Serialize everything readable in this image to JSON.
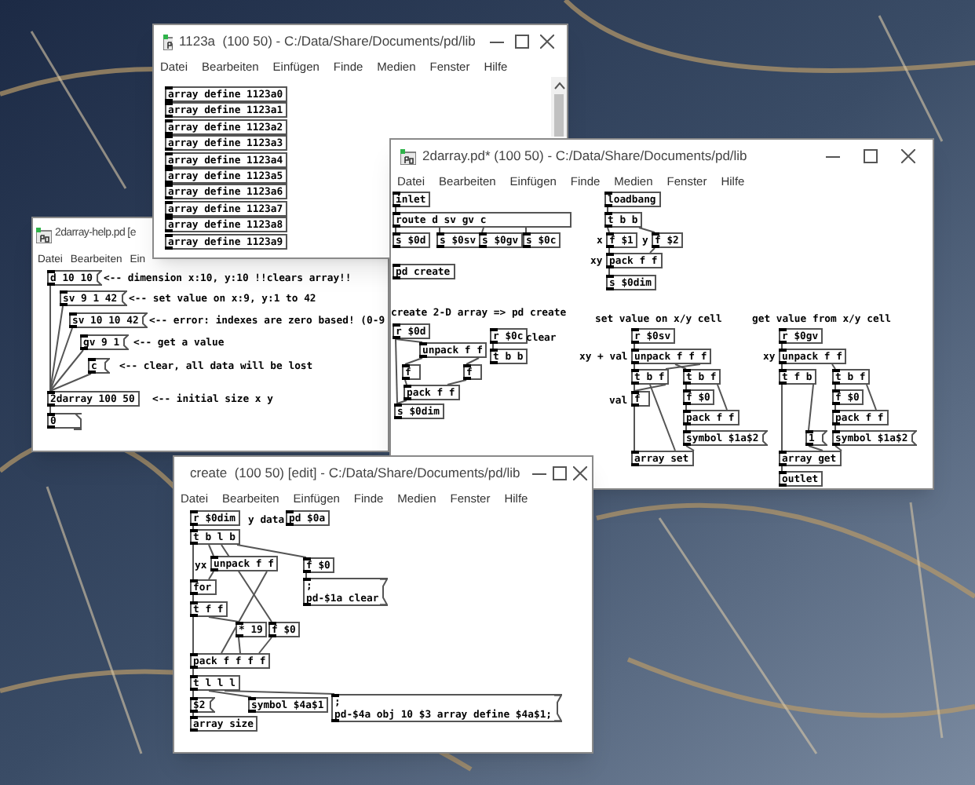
{
  "windows": [
    {
      "title": "1123a  (100 50) - C:/Data/Share/Documents/pd/lib",
      "menu": [
        "Datei",
        "Bearbeiten",
        "Einfügen",
        "Finde",
        "Medien",
        "Fenster",
        "Hilfe"
      ],
      "objects": [
        {
          "kind": "obj",
          "text": "array define 1123a0"
        },
        {
          "kind": "obj",
          "text": "array define 1123a1"
        },
        {
          "kind": "obj",
          "text": "array define 1123a2"
        },
        {
          "kind": "obj",
          "text": "array define 1123a3"
        },
        {
          "kind": "obj",
          "text": "array define 1123a4"
        },
        {
          "kind": "obj",
          "text": "array define 1123a5"
        },
        {
          "kind": "obj",
          "text": "array define 1123a6"
        },
        {
          "kind": "obj",
          "text": "array define 1123a7"
        },
        {
          "kind": "obj",
          "text": "array define 1123a8"
        },
        {
          "kind": "obj",
          "text": "array define 1123a9"
        }
      ]
    },
    {
      "title": "2darray.pd* (100 50) - C:/Data/Share/Documents/pd/lib",
      "menu": [
        "Datei",
        "Bearbeiten",
        "Einfügen",
        "Finde",
        "Medien",
        "Fenster",
        "Hilfe"
      ],
      "objects": [
        {
          "kind": "obj",
          "text": "inlet"
        },
        {
          "kind": "obj",
          "text": "route d sv gv c"
        },
        {
          "kind": "obj",
          "text": "s $0d"
        },
        {
          "kind": "obj",
          "text": "s $0sv"
        },
        {
          "kind": "obj",
          "text": "s $0gv"
        },
        {
          "kind": "obj",
          "text": "s $0c"
        },
        {
          "kind": "obj",
          "text": "pd create"
        },
        {
          "kind": "obj",
          "text": "loadbang"
        },
        {
          "kind": "obj",
          "text": "t b b"
        },
        {
          "kind": "comment",
          "text": "x"
        },
        {
          "kind": "obj",
          "text": "f $1"
        },
        {
          "kind": "comment",
          "text": "y"
        },
        {
          "kind": "obj",
          "text": "f $2"
        },
        {
          "kind": "comment",
          "text": "xy"
        },
        {
          "kind": "obj",
          "text": "pack f f"
        },
        {
          "kind": "obj",
          "text": "s $0dim"
        },
        {
          "kind": "comment",
          "text": "create 2-D array => pd create"
        },
        {
          "kind": "obj",
          "text": "r $0d"
        },
        {
          "kind": "obj",
          "text": "unpack f f"
        },
        {
          "kind": "obj",
          "text": "f"
        },
        {
          "kind": "obj",
          "text": "f"
        },
        {
          "kind": "obj",
          "text": "pack f f"
        },
        {
          "kind": "obj",
          "text": "s $0dim"
        },
        {
          "kind": "obj",
          "text": "r $0c"
        },
        {
          "kind": "comment",
          "text": "clear"
        },
        {
          "kind": "obj",
          "text": "t b b"
        },
        {
          "kind": "comment",
          "text": "set value on x/y cell"
        },
        {
          "kind": "obj",
          "text": "r $0sv"
        },
        {
          "kind": "comment",
          "text": "xy + val"
        },
        {
          "kind": "obj",
          "text": "unpack f f f"
        },
        {
          "kind": "obj",
          "text": "t b f"
        },
        {
          "kind": "obj",
          "text": "t b f"
        },
        {
          "kind": "comment",
          "text": "val"
        },
        {
          "kind": "obj",
          "text": "f"
        },
        {
          "kind": "obj",
          "text": "f $0"
        },
        {
          "kind": "obj",
          "text": "pack f f"
        },
        {
          "kind": "msg",
          "text": "symbol $1a$2"
        },
        {
          "kind": "obj",
          "text": "array set"
        },
        {
          "kind": "comment",
          "text": "get value from x/y cell"
        },
        {
          "kind": "obj",
          "text": "r $0gv"
        },
        {
          "kind": "comment",
          "text": "xy"
        },
        {
          "kind": "obj",
          "text": "unpack f f"
        },
        {
          "kind": "obj",
          "text": "t f b"
        },
        {
          "kind": "obj",
          "text": "t b f"
        },
        {
          "kind": "obj",
          "text": "f $0"
        },
        {
          "kind": "obj",
          "text": "pack f f"
        },
        {
          "kind": "msg",
          "text": "1"
        },
        {
          "kind": "msg",
          "text": "symbol $1a$2"
        },
        {
          "kind": "obj",
          "text": "array get"
        },
        {
          "kind": "obj",
          "text": "outlet"
        }
      ]
    },
    {
      "title": "2darray-help.pd [e",
      "menu": [
        "Datei",
        "Bearbeiten",
        "Ein"
      ],
      "objects": [
        {
          "kind": "msg",
          "text": "d 10 10"
        },
        {
          "kind": "comment",
          "text": "<-- dimension x:10, y:10 !!clears array!!"
        },
        {
          "kind": "msg",
          "text": "sv 9 1 42"
        },
        {
          "kind": "comment",
          "text": "<-- set value on x:9, y:1 to 42"
        },
        {
          "kind": "msg",
          "text": "sv 10 10 42"
        },
        {
          "kind": "comment",
          "text": "<-- error: indexes are zero based! (0-9"
        },
        {
          "kind": "msg",
          "text": "gv 9 1"
        },
        {
          "kind": "comment",
          "text": "<-- get a value"
        },
        {
          "kind": "msg",
          "text": "c"
        },
        {
          "kind": "comment",
          "text": "<-- clear, all data will be lost"
        },
        {
          "kind": "obj",
          "text": "2darray 100 50"
        },
        {
          "kind": "comment",
          "text": "<-- initial size x y"
        },
        {
          "kind": "number",
          "text": "0"
        }
      ]
    },
    {
      "title": "create  (100 50) [edit] - C:/Data/Share/Documents/pd/lib",
      "menu": [
        "Datei",
        "Bearbeiten",
        "Einfügen",
        "Finde",
        "Medien",
        "Fenster",
        "Hilfe"
      ],
      "objects": [
        {
          "kind": "obj",
          "text": "r $0dim"
        },
        {
          "kind": "comment",
          "text": "y data"
        },
        {
          "kind": "obj",
          "text": "pd $0a"
        },
        {
          "kind": "obj",
          "text": "t b l b"
        },
        {
          "kind": "comment",
          "text": "yx"
        },
        {
          "kind": "obj",
          "text": "unpack f f"
        },
        {
          "kind": "obj",
          "text": "f $0"
        },
        {
          "kind": "obj",
          "text": "for"
        },
        {
          "kind": "msg",
          "text": ";\npd-$1a clear"
        },
        {
          "kind": "obj",
          "text": "t f f"
        },
        {
          "kind": "obj",
          "text": "* 19"
        },
        {
          "kind": "obj",
          "text": "f $0"
        },
        {
          "kind": "obj",
          "text": "pack f f f f"
        },
        {
          "kind": "obj",
          "text": "t l l l"
        },
        {
          "kind": "msg",
          "text": "$2"
        },
        {
          "kind": "obj",
          "text": "symbol $4a$1"
        },
        {
          "kind": "msg",
          "text": ";\npd-$4a obj 10 $3 array define $4a$1;"
        },
        {
          "kind": "obj",
          "text": "array size"
        }
      ]
    }
  ]
}
